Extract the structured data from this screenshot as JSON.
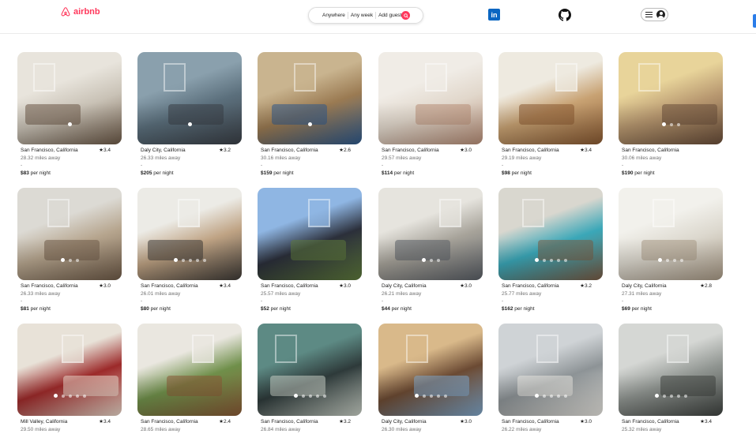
{
  "header": {
    "logo_text": "airbnb",
    "search": {
      "anywhere": "Anywhere",
      "any_week": "Any week",
      "add_guests": "Add guests"
    },
    "linkedin_text": "in"
  },
  "colors": {
    "brand": "#ff385c",
    "linkedin": "#0a66c2",
    "muted_text": "#717171"
  },
  "listings": [
    {
      "location": "San Francisco, California",
      "rating": "★3.4",
      "distance": "28.32 miles away",
      "dates": "-",
      "price": "$83",
      "price_suffix": " per night",
      "photo_colors": [
        "#e8e4dc",
        "#c9c2b6",
        "#6d5a48"
      ],
      "dots": 1,
      "active_dot": 0
    },
    {
      "location": "Daly City, California",
      "rating": "★3.2",
      "distance": "26.33 miles away",
      "dates": "-",
      "price": "$205",
      "price_suffix": " per night",
      "photo_colors": [
        "#8aa0ad",
        "#5b6f7c",
        "#3b4047"
      ],
      "dots": 1,
      "active_dot": 0
    },
    {
      "location": "San Francisco, California",
      "rating": "★2.6",
      "distance": "30.16 miles away",
      "dates": "-",
      "price": "$159",
      "price_suffix": " per night",
      "photo_colors": [
        "#c9b48f",
        "#9a7a52",
        "#2f5a8c"
      ],
      "dots": 1,
      "active_dot": 0
    },
    {
      "location": "San Francisco, California",
      "rating": "★3.0",
      "distance": "29.57 miles away",
      "dates": "-",
      "price": "$114",
      "price_suffix": " per night",
      "photo_colors": [
        "#f0ece6",
        "#e1d7cb",
        "#b98f78"
      ],
      "dots": 0,
      "active_dot": 0
    },
    {
      "location": "San Francisco, California",
      "rating": "★3.4",
      "distance": "29.19 miles away",
      "dates": "-",
      "price": "$98",
      "price_suffix": " per night",
      "photo_colors": [
        "#eeeae0",
        "#c8a273",
        "#8a5a32"
      ],
      "dots": 0,
      "active_dot": 0
    },
    {
      "location": "San Francisco, California",
      "rating": "",
      "distance": "30.06 miles away",
      "dates": "-",
      "price": "$190",
      "price_suffix": " per night",
      "photo_colors": [
        "#e8d49a",
        "#b89870",
        "#6a4e3a"
      ],
      "dots": 3,
      "active_dot": 0
    },
    {
      "location": "San Francisco, California",
      "rating": "★3.0",
      "distance": "26.33 miles away",
      "dates": "-",
      "price": "$81",
      "price_suffix": " per night",
      "photo_colors": [
        "#dcdad4",
        "#b6a58e",
        "#6f5b48"
      ],
      "dots": 3,
      "active_dot": 0
    },
    {
      "location": "San Francisco, California",
      "rating": "★3.4",
      "distance": "26.01 miles away",
      "dates": "-",
      "price": "$80",
      "price_suffix": " per night",
      "photo_colors": [
        "#ecebe6",
        "#bfa384",
        "#3e3a36"
      ],
      "dots": 5,
      "active_dot": 0
    },
    {
      "location": "San Francisco, California",
      "rating": "★3.0",
      "distance": "25.57 miles away",
      "dates": "-",
      "price": "$52",
      "price_suffix": " per night",
      "photo_colors": [
        "#8fb6e3",
        "#2b2f3a",
        "#5e7a3c"
      ],
      "dots": 0,
      "active_dot": 0
    },
    {
      "location": "Daly City, California",
      "rating": "★3.0",
      "distance": "26.21 miles away",
      "dates": "-",
      "price": "$44",
      "price_suffix": " per night",
      "photo_colors": [
        "#e6e4de",
        "#a7a39a",
        "#5a5f66"
      ],
      "dots": 3,
      "active_dot": 0
    },
    {
      "location": "San Francisco, California",
      "rating": "★3.2",
      "distance": "25.77 miles away",
      "dates": "-",
      "price": "$162",
      "price_suffix": " per night",
      "photo_colors": [
        "#d9d7cf",
        "#3aa7b8",
        "#7a5c44"
      ],
      "dots": 5,
      "active_dot": 0
    },
    {
      "location": "Daly City, California",
      "rating": "★2.8",
      "distance": "27.31 miles away",
      "dates": "-",
      "price": "$69",
      "price_suffix": " per night",
      "photo_colors": [
        "#f2f1ec",
        "#dcd8ce",
        "#a99a86"
      ],
      "dots": 4,
      "active_dot": 0
    },
    {
      "location": "Mill Valley, California",
      "rating": "★3.4",
      "distance": "29.50 miles away",
      "dates": "",
      "price": "",
      "price_suffix": "",
      "photo_colors": [
        "#e8e2d8",
        "#9c2a2a",
        "#e9d6c8"
      ],
      "dots": 5,
      "active_dot": 0
    },
    {
      "location": "San Francisco, California",
      "rating": "★2.4",
      "distance": "28.65 miles away",
      "dates": "",
      "price": "",
      "price_suffix": "",
      "photo_colors": [
        "#eae7e0",
        "#6f8f4a",
        "#8a5a36"
      ],
      "dots": 0,
      "active_dot": 0
    },
    {
      "location": "San Francisco, California",
      "rating": "★3.2",
      "distance": "26.84 miles away",
      "dates": "",
      "price": "",
      "price_suffix": "",
      "photo_colors": [
        "#5d8a84",
        "#2e3a3a",
        "#c9d0c6"
      ],
      "dots": 5,
      "active_dot": 0
    },
    {
      "location": "Daly City, California",
      "rating": "★3.0",
      "distance": "26.30 miles away",
      "dates": "",
      "price": "",
      "price_suffix": "",
      "photo_colors": [
        "#d9b98a",
        "#6b4a33",
        "#7fa6c9"
      ],
      "dots": 5,
      "active_dot": 0
    },
    {
      "location": "San Francisco, California",
      "rating": "★3.0",
      "distance": "26.22 miles away",
      "dates": "",
      "price": "",
      "price_suffix": "",
      "photo_colors": [
        "#cfd3d6",
        "#8d9396",
        "#e8e6e0"
      ],
      "dots": 5,
      "active_dot": 0
    },
    {
      "location": "San Francisco, California",
      "rating": "★3.4",
      "distance": "25.32 miles away",
      "dates": "",
      "price": "",
      "price_suffix": "",
      "photo_colors": [
        "#d5d7d4",
        "#8f9490",
        "#3f4340"
      ],
      "dots": 5,
      "active_dot": 0
    }
  ]
}
